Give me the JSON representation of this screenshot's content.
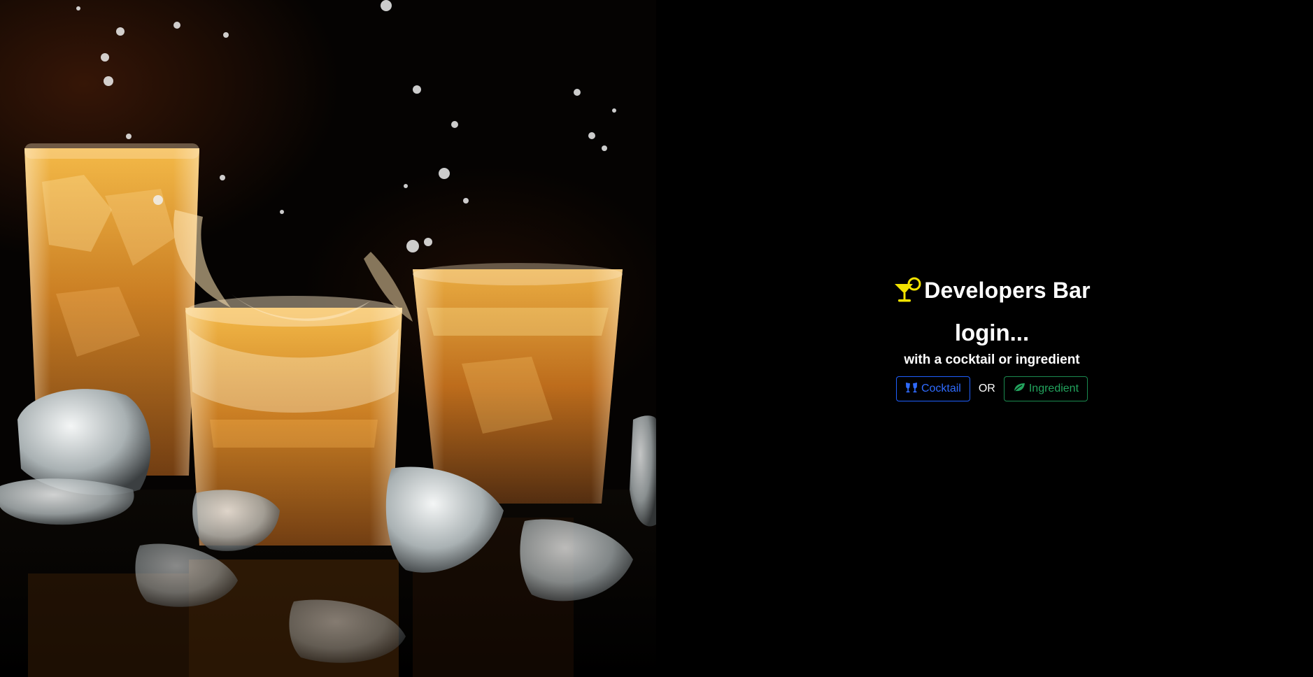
{
  "hero": {
    "image_subject": "whiskey-glasses-with-ice-splash"
  },
  "brand": {
    "icon": "cocktail-glass-icon",
    "title": "Developers Bar",
    "icon_color": "#f2e300"
  },
  "login": {
    "heading": "login...",
    "subheading": "with a cocktail or ingredient"
  },
  "actions": {
    "cocktail_label": "Cocktail",
    "cocktail_icon": "glasses-cheers-icon",
    "cocktail_color": "#2f6bff",
    "or_label": "OR",
    "ingredient_label": "Ingredient",
    "ingredient_icon": "leaf-icon",
    "ingredient_color": "#22a35d"
  }
}
